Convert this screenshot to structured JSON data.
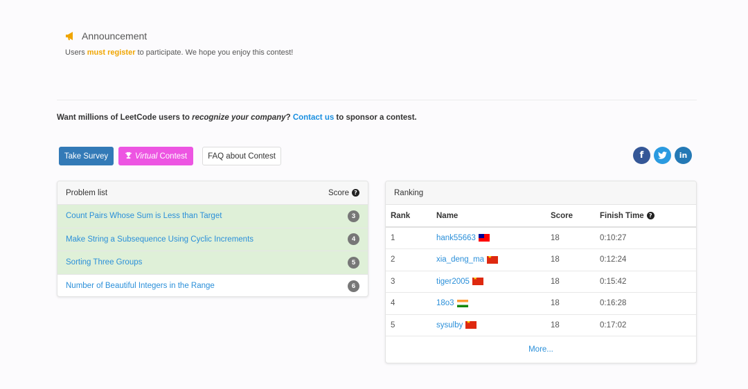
{
  "announcement": {
    "title": "Announcement",
    "text_before": "Users ",
    "highlight": "must register",
    "text_after": " to participate. We hope you enjoy this contest!",
    "icon": "megaphone-icon",
    "highlight_color": "#f0a500"
  },
  "sponsor": {
    "text_before": "Want millions of LeetCode users to ",
    "emphasis": "recognize your company",
    "text_middle": "? ",
    "link": "Contact us",
    "text_after": " to sponsor a contest."
  },
  "buttons": {
    "survey": "Take Survey",
    "virtual_em": "Virtual",
    "virtual_rest": " Contest",
    "faq": "FAQ about Contest"
  },
  "social": {
    "facebook": "f",
    "linkedin": "in"
  },
  "problems": {
    "header": "Problem list",
    "score_label": "Score",
    "items": [
      {
        "title": "Count Pairs Whose Sum is Less than Target",
        "score": "3",
        "solved": true
      },
      {
        "title": "Make String a Subsequence Using Cyclic Increments",
        "score": "4",
        "solved": true
      },
      {
        "title": "Sorting Three Groups",
        "score": "5",
        "solved": true
      },
      {
        "title": "Number of Beautiful Integers in the Range",
        "score": "6",
        "solved": false
      }
    ]
  },
  "ranking": {
    "header": "Ranking",
    "columns": {
      "rank": "Rank",
      "name": "Name",
      "score": "Score",
      "finish": "Finish Time"
    },
    "rows": [
      {
        "rank": "1",
        "name": "hank55663",
        "flag": "tw",
        "score": "18",
        "time": "0:10:27"
      },
      {
        "rank": "2",
        "name": "xia_deng_ma",
        "flag": "cn",
        "score": "18",
        "time": "0:12:24"
      },
      {
        "rank": "3",
        "name": "tiger2005",
        "flag": "cn",
        "score": "18",
        "time": "0:15:42"
      },
      {
        "rank": "4",
        "name": "18o3",
        "flag": "in",
        "score": "18",
        "time": "0:16:28"
      },
      {
        "rank": "5",
        "name": "sysulby",
        "flag": "cn",
        "score": "18",
        "time": "0:17:02"
      }
    ],
    "more": "More..."
  },
  "colors": {
    "survey_btn": "#337ab7",
    "virtual_btn": "#ed55e2",
    "solved_row": "#dff0d8",
    "link": "#2a8fd9"
  }
}
